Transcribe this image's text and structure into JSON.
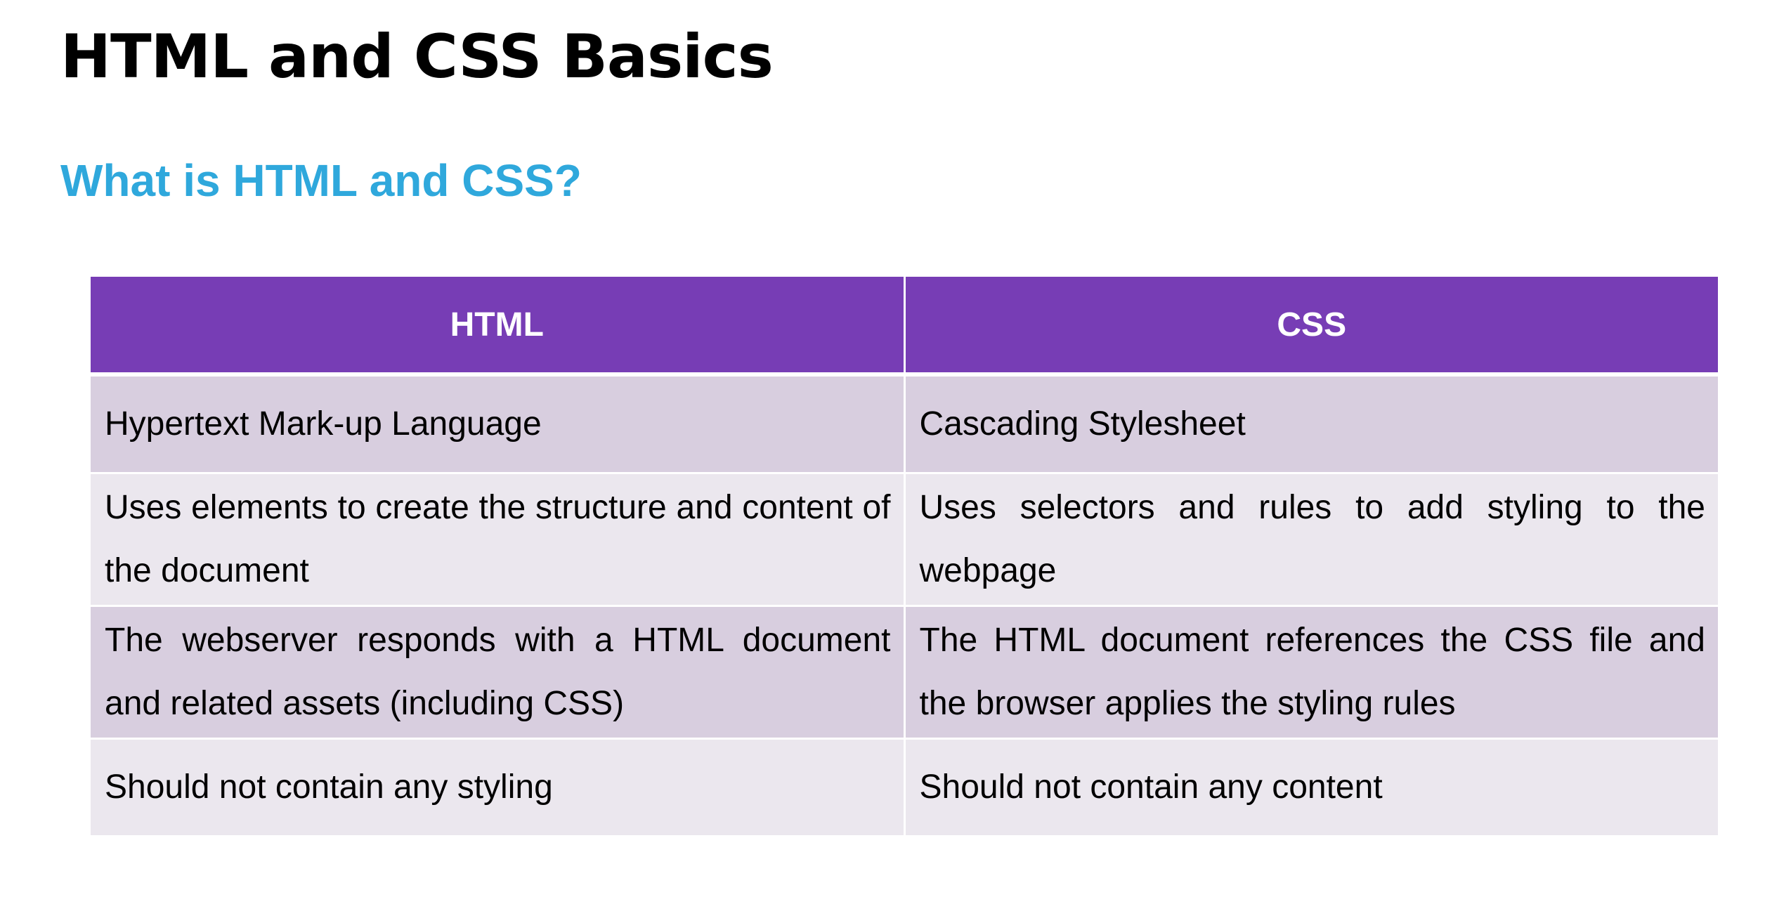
{
  "slide": {
    "title": "HTML and CSS Basics",
    "subtitle": "What is HTML and CSS?"
  },
  "table": {
    "headers": [
      "HTML",
      "CSS"
    ],
    "rows": [
      [
        "Hypertext Mark-up Language",
        "Cascading Stylesheet"
      ],
      [
        "Uses elements to create the structure and content of the document",
        "Uses selectors and rules to add styling to the webpage"
      ],
      [
        "The webserver responds with a HTML document and related assets (including CSS)",
        "The HTML document references the CSS file and the browser applies the styling rules"
      ],
      [
        "Should not contain any styling",
        "Should not contain any content"
      ]
    ]
  },
  "colors": {
    "header_bg": "#773db5",
    "subtitle": "#2fa8dc",
    "row_dark": "#d8cedf",
    "row_light": "#ebe7ee"
  }
}
